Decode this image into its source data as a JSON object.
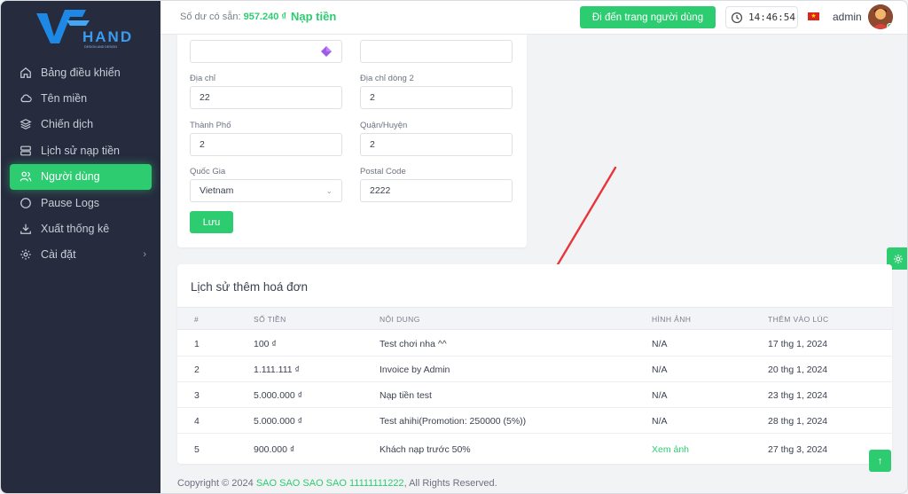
{
  "sidebar": {
    "logo_text": "HANDY",
    "logo_sub": "DESIGN AND DESIGN",
    "items": [
      {
        "label": "Bảng điều khiển",
        "icon": "home-icon"
      },
      {
        "label": "Tên miền",
        "icon": "cloud-icon"
      },
      {
        "label": "Chiến dịch",
        "icon": "layers-icon"
      },
      {
        "label": "Lịch sử nạp tiền",
        "icon": "server-icon"
      },
      {
        "label": "Người dùng",
        "icon": "users-icon",
        "active": true
      },
      {
        "label": "Pause Logs",
        "icon": "circle-icon"
      },
      {
        "label": "Xuất thống kê",
        "icon": "download-icon"
      },
      {
        "label": "Cài đặt",
        "icon": "gear-icon"
      }
    ]
  },
  "topbar": {
    "balance_label": "Số dư có sẵn:",
    "balance_amount": "957.240 ₫",
    "topup_label": "Nạp tiền",
    "goto_user_button": "Đi đến trang người dùng",
    "clock": "14:46:54",
    "user": "admin"
  },
  "form": {
    "address_label": "Địa chỉ",
    "address_value": "22",
    "address2_label": "Địa chỉ dòng 2",
    "address2_value": "2",
    "city_label": "Thành Phố",
    "city_value": "2",
    "district_label": "Quận/Huyện",
    "district_value": "2",
    "country_label": "Quốc Gia",
    "country_value": "Vietnam",
    "postal_label": "Postal Code",
    "postal_value": "2222",
    "save_button": "Lưu"
  },
  "invoice_table": {
    "title": "Lịch sử thêm hoá đơn",
    "headers": [
      "#",
      "SỐ TIỀN",
      "NỘI DUNG",
      "HÌNH ẢNH",
      "THÊM VÀO LÚC"
    ],
    "rows": [
      {
        "no": "1",
        "amount": "100 ₫",
        "content": "Test chơi nha ^^",
        "image": "N/A",
        "added": "17 thg 1, 2024"
      },
      {
        "no": "2",
        "amount": "1.111.111 ₫",
        "content": "Invoice by Admin",
        "image": "N/A",
        "added": "20 thg 1, 2024"
      },
      {
        "no": "3",
        "amount": "5.000.000 ₫",
        "content": "Nạp tiền test",
        "image": "N/A",
        "added": "23 thg 1, 2024"
      },
      {
        "no": "4",
        "amount": "5.000.000 ₫",
        "content": "Test ahihi(Promotion: 250000 (5%))",
        "image": "N/A",
        "added": "28 thg 1, 2024"
      },
      {
        "no": "5",
        "amount": "900.000 ₫",
        "content": "Khách nạp trước 50%",
        "image": "Xem ảnh",
        "added": "27 thg 3, 2024"
      }
    ]
  },
  "footer": {
    "prefix": "Copyright © 2024",
    "brand": "SAO SAO SAO SAO 11111111222",
    "suffix": ", All Rights Reserved."
  },
  "colors": {
    "accent": "#2ecc71",
    "sidebar_bg": "#262b3e",
    "annotation_arrow": "#e8353b"
  }
}
